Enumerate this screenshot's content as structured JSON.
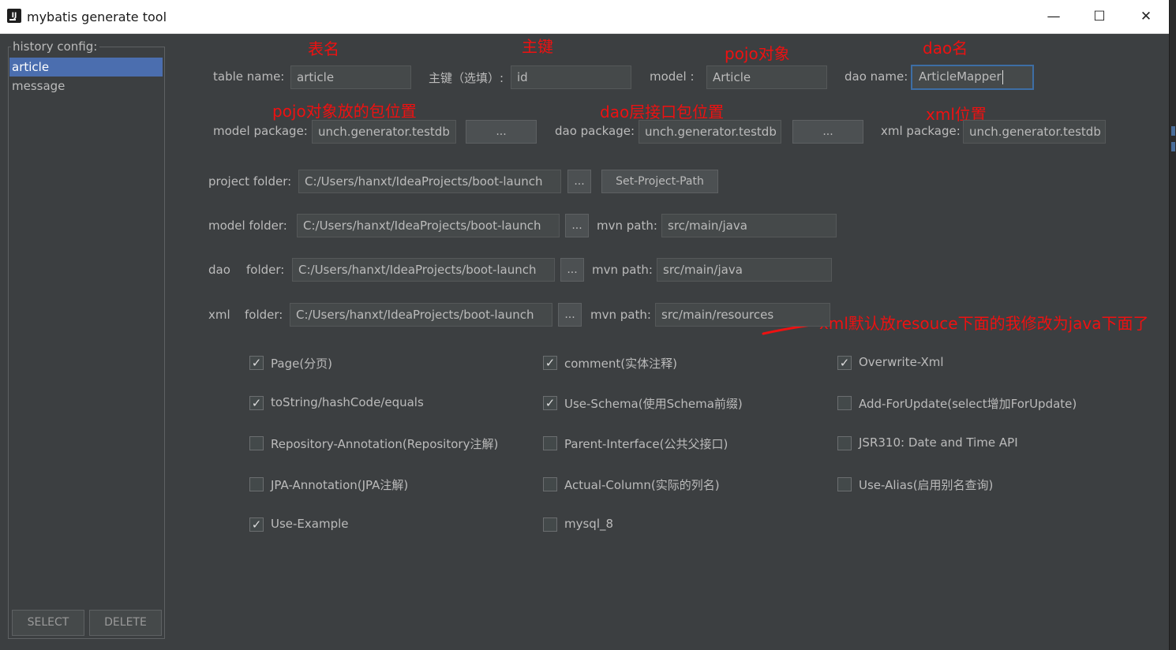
{
  "window": {
    "title": "mybatis generate tool",
    "minimize": "—",
    "maximize": "☐",
    "close": "✕"
  },
  "history": {
    "legend": "history config:",
    "items": [
      "article",
      "message"
    ],
    "select_label": "SELECT",
    "delete_label": "DELETE"
  },
  "form": {
    "table_name_label": "table  name:",
    "table_name_value": "article",
    "pk_label": "主键（选填）:",
    "pk_value": "id",
    "model_label": "model  :",
    "model_value": "Article",
    "dao_name_label": "dao name:",
    "dao_name_value": "ArticleMapper",
    "model_package_label": "model package:",
    "model_package_value": "unch.generator.testdb",
    "dao_package_label": "dao package:",
    "dao_package_value": "unch.generator.testdb",
    "xml_package_label": "xml package:",
    "xml_package_value": "unch.generator.testdb",
    "browse_label": "...",
    "project_folder_label": "project folder:",
    "project_folder_value": "C:/Users/hanxt/IdeaProjects/boot-launch",
    "set_project_path_label": "Set-Project-Path",
    "model_folder_label": "model  folder:",
    "model_folder_value": "C:/Users/hanxt/IdeaProjects/boot-launch",
    "dao_label": "dao",
    "dao_folder_label": "folder:",
    "dao_folder_value": "C:/Users/hanxt/IdeaProjects/boot-launch",
    "xml_label": "xml",
    "xml_folder_label": "folder:",
    "xml_folder_value": "C:/Users/hanxt/IdeaProjects/boot-launch",
    "mvn_path_label": "mvn path:",
    "model_mvn_value": "src/main/java",
    "dao_mvn_value": "src/main/java",
    "xml_mvn_value": "src/main/resources"
  },
  "annotations": {
    "table": "表名",
    "pk": "主键",
    "pojo": "pojo对象",
    "dao": "dao名",
    "pojo_pkg": "pojo对象放的包位置",
    "dao_pkg": "dao层接口包位置",
    "xml_pos": "xml位置",
    "xml_note": "xml默认放resouce下面的我修改为java下面了"
  },
  "checkboxes": [
    {
      "label": "Page(分页)",
      "checked": true
    },
    {
      "label": "comment(实体注释)",
      "checked": true
    },
    {
      "label": "Overwrite-Xml",
      "checked": true
    },
    {
      "label": "toString/hashCode/equals",
      "checked": true
    },
    {
      "label": "Use-Schema(使用Schema前缀)",
      "checked": true
    },
    {
      "label": "Add-ForUpdate(select增加ForUpdate)",
      "checked": false
    },
    {
      "label": "Repository-Annotation(Repository注解)",
      "checked": false
    },
    {
      "label": "Parent-Interface(公共父接口)",
      "checked": false
    },
    {
      "label": "JSR310: Date and Time API",
      "checked": false
    },
    {
      "label": "JPA-Annotation(JPA注解)",
      "checked": false
    },
    {
      "label": "Actual-Column(实际的列名)",
      "checked": false
    },
    {
      "label": "Use-Alias(启用别名查询)",
      "checked": false
    },
    {
      "label": "Use-Example",
      "checked": true
    },
    {
      "label": "mysql_8",
      "checked": false
    }
  ],
  "colors": {
    "annotation": "#ee1111",
    "selection": "#4b6eaf",
    "background": "#3c3f41"
  }
}
